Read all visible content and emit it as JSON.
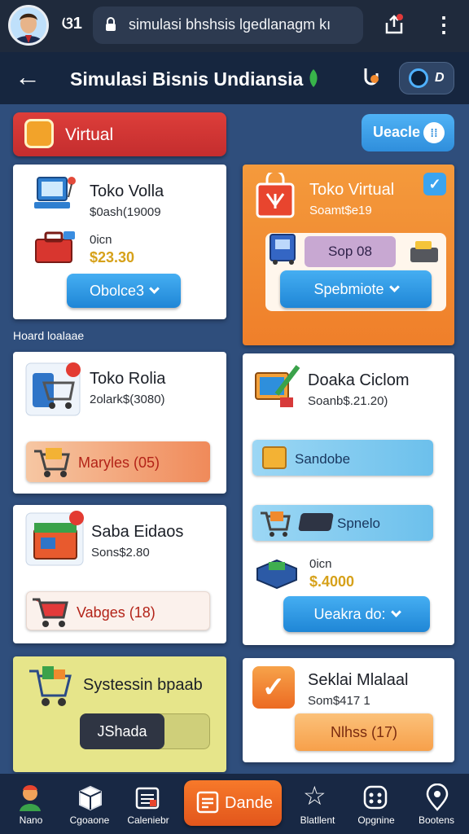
{
  "browser": {
    "tab_count": "ଓ1",
    "url": "simulasi bhshsis  lgedlanagm kı"
  },
  "header": {
    "title": "Simulasi Bisnis Undiansia",
    "profile_label": "D"
  },
  "filters": {
    "virtual_label": "Virtual",
    "grade_label": "Ueacle",
    "grade_icon": "⁞⁞"
  },
  "section_label": "Hoard loalaae",
  "cards": {
    "toko_volla": {
      "title": "Toko Volla",
      "subtitle": "$0ash(19009",
      "item_label": "0icn",
      "price": "$23.30",
      "button": "Obolce3"
    },
    "toko_virtual": {
      "title": "Toko Virtual",
      "subtitle": "Soamt$e19",
      "chip_label": "Sop 08",
      "button": "Spebmiote"
    },
    "toko_rolia": {
      "title": "Toko Rolia",
      "subtitle": "2olark$(3080)",
      "bar_label": "Maryles (05)"
    },
    "doaka_ciclom": {
      "title": "Doaka Ciclom",
      "subtitle": "Soanb$.21.20)",
      "bar1_label": "Sandobe",
      "bar2_label": "Spnelo",
      "item_label": "0icn",
      "price": "$.4000",
      "button": "Ueakra do:"
    },
    "saba_eidaos": {
      "title": "Saba Eidaos",
      "subtitle": "Sons$2.80",
      "bar_label": "Vabges (18)"
    },
    "systessin": {
      "title": "Systessin bpaab",
      "toggle_label": "JShada"
    },
    "seklai_mlalaal": {
      "title": "Seklai Mlalaal",
      "subtitle": "Som$417 1",
      "button": "Nlhss (17)"
    }
  },
  "nav": {
    "items": [
      {
        "label": "Nano",
        "icon": "avatar-icon"
      },
      {
        "label": "Cgoaone",
        "icon": "box-icon"
      },
      {
        "label": "Caleniebr",
        "icon": "calendar-icon"
      },
      {
        "label": "Dande",
        "icon": "list-icon"
      },
      {
        "label": "Blatllent",
        "icon": "star-icon"
      },
      {
        "label": "Opgnine",
        "icon": "game-icon"
      },
      {
        "label": "Bootens",
        "icon": "location-icon"
      }
    ]
  },
  "colors": {
    "accent_red": "#d43534",
    "accent_blue": "#2f8edc",
    "accent_orange": "#f28a2e",
    "background": "#2f4e7c"
  }
}
